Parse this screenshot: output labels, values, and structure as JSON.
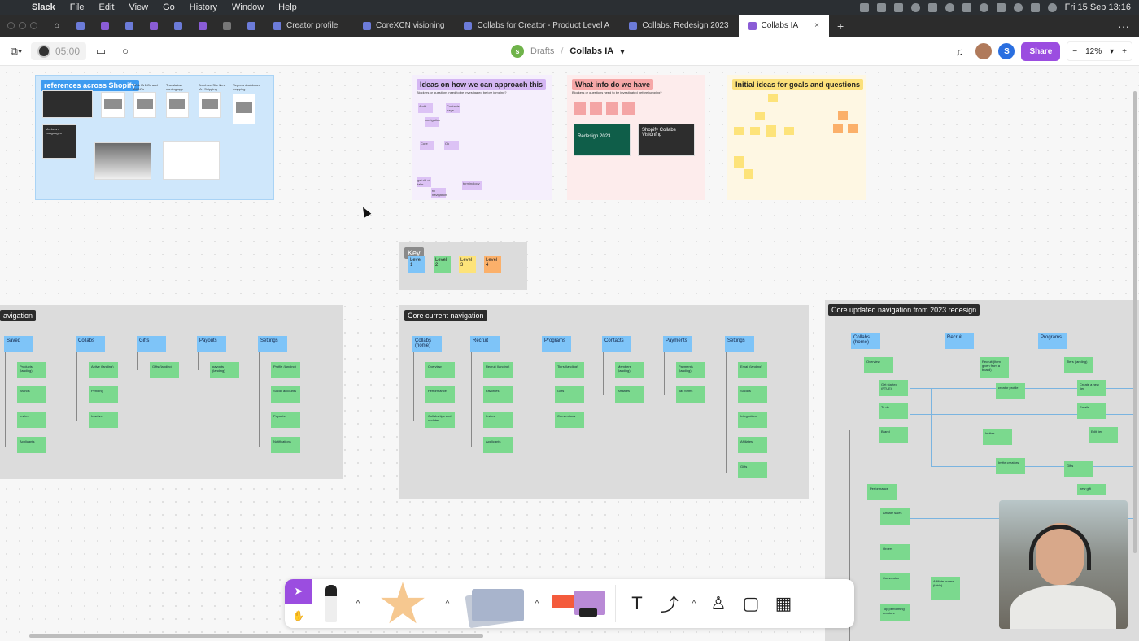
{
  "menubar": {
    "app": "Slack",
    "items": [
      "File",
      "Edit",
      "View",
      "Go",
      "History",
      "Window",
      "Help"
    ],
    "clock": "Fri 15 Sep  13:16"
  },
  "tabs": {
    "items": [
      {
        "label": "Creator profile"
      },
      {
        "label": "CoreXCN visioning"
      },
      {
        "label": "Collabs for Creator - Product Level A"
      },
      {
        "label": "Collabs: Redesign 2023"
      },
      {
        "label": "Collabs IA",
        "active": true
      }
    ],
    "add": "+",
    "more": "···",
    "close": "×"
  },
  "toolbar": {
    "timer": "05:00",
    "breadcrumb_root": "Drafts",
    "separator": "/",
    "file_name": "Collabs IA",
    "avatar_letter": "S",
    "share": "Share",
    "zoom_minus": "−",
    "zoom": "12%",
    "zoom_plus": "+"
  },
  "frames": {
    "references": {
      "title": "references across Shopify",
      "labels": [
        "Web IA DOs and DONTs",
        "Translation naming app",
        "Brochure Site New IA - Shipping",
        "Reports dashboard mapping",
        "Markets / Languages"
      ]
    },
    "ideas": {
      "title": "Ideas on how we can approach this",
      "subtitle": "Blockers or questions need to be investigated before jumping?",
      "stickies": [
        "Audit",
        "Contacts page",
        "navigation",
        "Core",
        "Ok",
        "get rid of tabs",
        "fix navigation",
        "terminology"
      ]
    },
    "info": {
      "title": "What info do we have",
      "subtitle": "Blockers or questions need to be investigated before jumping?",
      "cards": [
        "Redesign 2023",
        "Shopify Collabs Visioning"
      ]
    },
    "goals": {
      "title": "Initial ideas for goals and questions"
    }
  },
  "key": {
    "title": "Key",
    "levels": [
      "Level 1",
      "Level 2",
      "Level 3",
      "Level 4"
    ]
  },
  "nav_left": {
    "title": "avigation",
    "columns": [
      {
        "head": "Saved",
        "items": [
          "Products (landing)",
          "Brands",
          "Invites",
          "Applicants"
        ]
      },
      {
        "head": "Collabs",
        "items": [
          "Active (landing)",
          "Pending",
          "Inactive"
        ]
      },
      {
        "head": "Gifts",
        "items": [
          "Gifts (landing)"
        ]
      },
      {
        "head": "Payouts",
        "items": [
          "payouts (landing)"
        ]
      },
      {
        "head": "Settings",
        "items": [
          "Profile (landing)",
          "Social accounts",
          "Payouts",
          "Notifications"
        ]
      }
    ]
  },
  "nav_core": {
    "title": "Core current navigation",
    "columns": [
      {
        "head": "Collabs (home)",
        "items": [
          "Overview",
          "Performance",
          "Collabs tips and updates"
        ]
      },
      {
        "head": "Recruit",
        "items": [
          "Recruit (landing)",
          "Favorites",
          "Invites",
          "Applicants"
        ]
      },
      {
        "head": "Programs",
        "items": [
          "Tiers (landing)",
          "Gifts",
          "Conversions"
        ]
      },
      {
        "head": "Contacts",
        "items": [
          "Members (landing)",
          "Affiliates"
        ]
      },
      {
        "head": "Payments",
        "items": [
          "Payments (landing)",
          "Tax forms"
        ]
      },
      {
        "head": "Settings",
        "items": [
          "Email (landing)",
          "Socials",
          "Integrations",
          "Affiliates",
          "Gifts"
        ]
      }
    ]
  },
  "nav_updated": {
    "title": "Core updated navigation from 2023 redesign",
    "columns": [
      {
        "head": "Collabs (home)"
      },
      {
        "head": "Recruit"
      },
      {
        "head": "Programs"
      }
    ],
    "stickies": [
      "Overview",
      "Get started (FTUE)",
      "To do",
      "Brand",
      "Performance",
      "Affiliate sales",
      "Orders",
      "Conversion",
      "Top performing creators",
      "Recruit (Item given from a board)",
      "creator profile",
      "Invites",
      "Invite creators",
      "Tiers (landing)",
      "Create a new tier",
      "Emails",
      "Gifts",
      "new gift",
      "Edit tier",
      "Affiliate orders (table)"
    ]
  },
  "colors": {
    "accent": "#9b4de0",
    "level1": "#7ec4f8",
    "level2": "#7bd98e",
    "level3": "#fde37a",
    "level4": "#fbb06a"
  }
}
